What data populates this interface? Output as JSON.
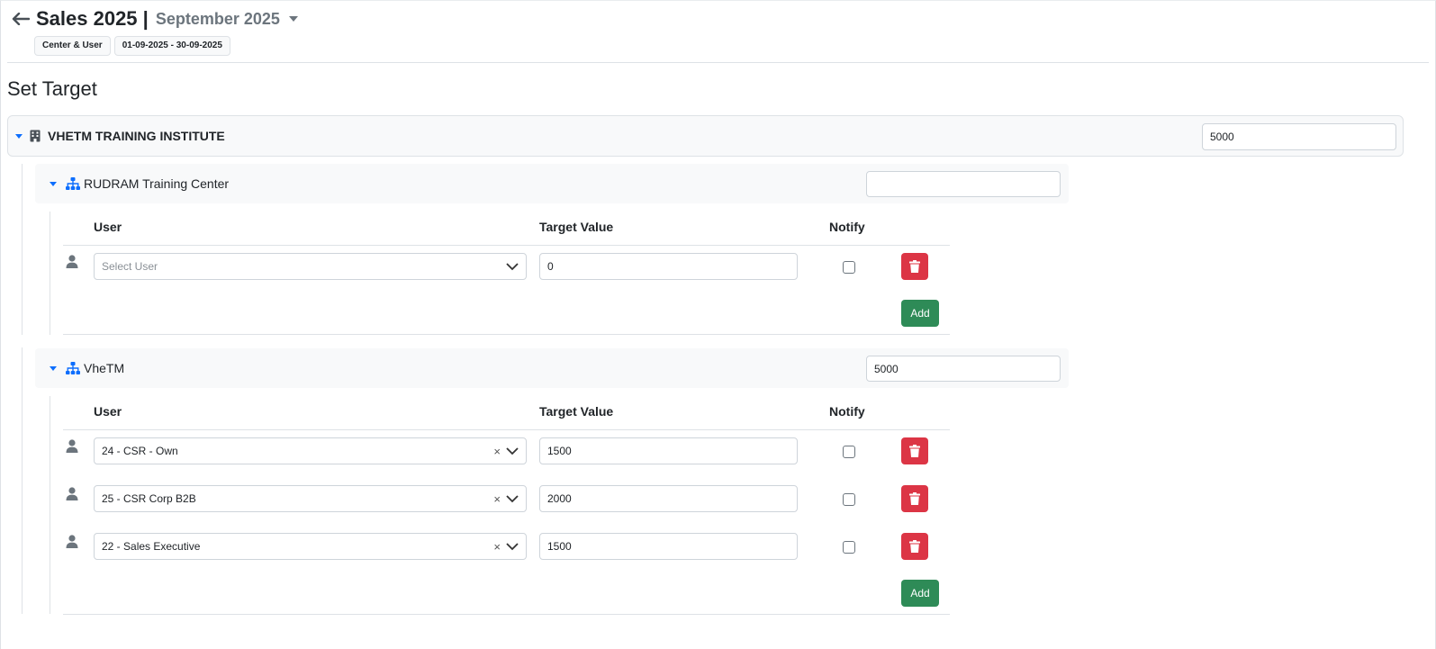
{
  "header": {
    "title": "Sales 2025 |",
    "period": "September 2025",
    "badges": [
      "Center & User",
      "01-09-2025 - 30-09-2025"
    ]
  },
  "section_title": "Set Target",
  "organization": {
    "name": "VHETM TRAINING INSTITUTE",
    "target": "5000"
  },
  "columns": {
    "user": "User",
    "target_value": "Target Value",
    "notify": "Notify"
  },
  "centers": [
    {
      "name": "RUDRAM Training Center",
      "target": "",
      "rows": [
        {
          "user": "",
          "placeholder": "Select User",
          "target": "0",
          "notify": false
        }
      ],
      "add_label": "Add"
    },
    {
      "name": "VheTM",
      "target": "5000",
      "rows": [
        {
          "user": "24 - CSR - Own",
          "target": "1500",
          "notify": false
        },
        {
          "user": "25 - CSR Corp B2B",
          "target": "2000",
          "notify": false
        },
        {
          "user": "22 - Sales Executive",
          "target": "1500",
          "notify": false
        }
      ],
      "add_label": "Add"
    }
  ],
  "colors": {
    "accent": "#0d6efd",
    "delete": "#dc3545",
    "add": "#2e8b57"
  },
  "icons": [
    "back-arrow-icon",
    "caret-down-icon",
    "building-icon",
    "sitemap-icon",
    "user-icon",
    "chevron-down-icon",
    "clear-icon",
    "trash-icon"
  ]
}
